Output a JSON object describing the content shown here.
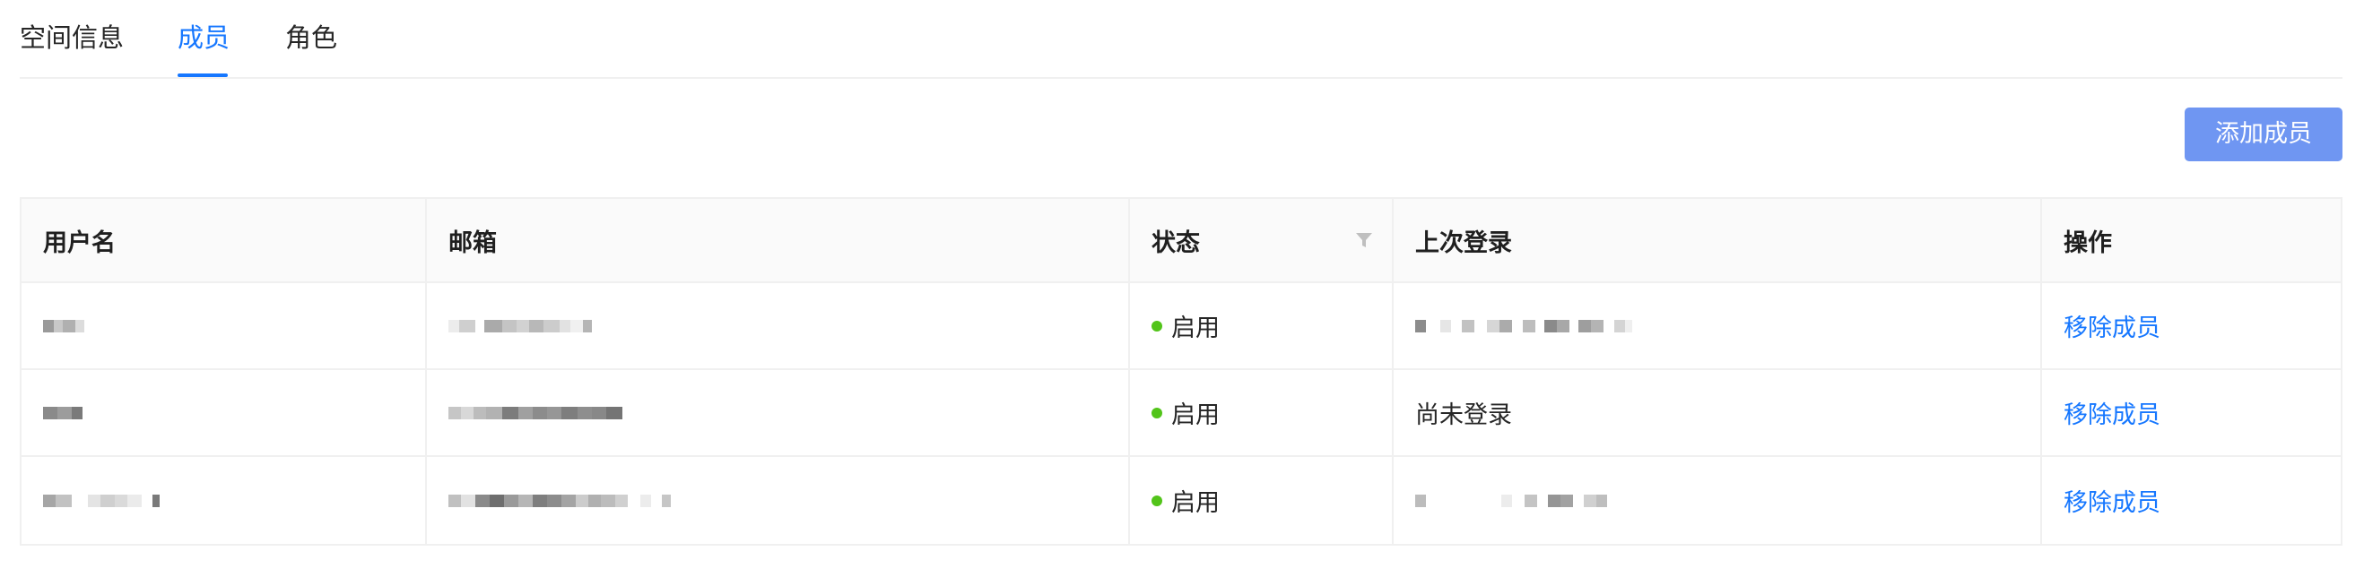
{
  "tabs": [
    {
      "label": "空间信息",
      "active": false
    },
    {
      "label": "成员",
      "active": true
    },
    {
      "label": "角色",
      "active": false
    }
  ],
  "toolbar": {
    "add_member_label": "添加成员"
  },
  "table": {
    "columns": [
      "用户名",
      "邮箱",
      "状态",
      "上次登录",
      "操作"
    ],
    "rows": [
      {
        "status": "启用",
        "last_login": "",
        "action": "移除成员"
      },
      {
        "status": "启用",
        "last_login": "尚未登录",
        "action": "移除成员"
      },
      {
        "status": "启用",
        "last_login": "",
        "action": "移除成员"
      }
    ]
  },
  "colors": {
    "accent": "#1677ff",
    "button": "#6f96f2",
    "status_enabled": "#52c41a",
    "border": "#f0f0f0",
    "header_bg": "#fafafa"
  },
  "icons": {
    "status_filter": "filter-icon"
  }
}
